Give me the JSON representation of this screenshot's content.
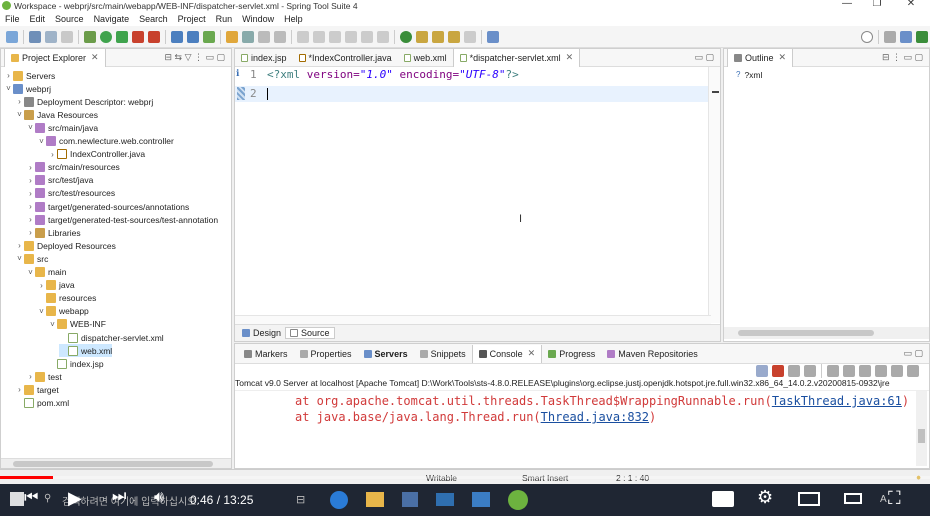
{
  "window": {
    "title": "Workspace - webprj/src/main/webapp/WEB-INF/dispatcher-servlet.xml - Spring Tool Suite 4"
  },
  "menu": [
    "File",
    "Edit",
    "Source",
    "Navigate",
    "Search",
    "Project",
    "Run",
    "Window",
    "Help"
  ],
  "explorer": {
    "title": "Project Explorer",
    "items": [
      {
        "label": "Servers",
        "icon": "folder",
        "arrow": "›",
        "depth": 0
      },
      {
        "label": "webprj",
        "icon": "proj",
        "arrow": "˅",
        "depth": 0
      },
      {
        "label": "Deployment Descriptor: webprj",
        "icon": "web",
        "arrow": "›",
        "depth": 1
      },
      {
        "label": "Java Resources",
        "icon": "lib",
        "arrow": "˅",
        "depth": 1
      },
      {
        "label": "src/main/java",
        "icon": "pkg",
        "arrow": "˅",
        "depth": 2
      },
      {
        "label": "com.newlecture.web.controller",
        "icon": "pkg",
        "arrow": "˅",
        "depth": 3
      },
      {
        "label": "IndexController.java",
        "icon": "java",
        "arrow": "›",
        "depth": 4
      },
      {
        "label": "src/main/resources",
        "icon": "pkg",
        "arrow": "›",
        "depth": 2
      },
      {
        "label": "src/test/java",
        "icon": "pkg",
        "arrow": "›",
        "depth": 2
      },
      {
        "label": "src/test/resources",
        "icon": "pkg",
        "arrow": "›",
        "depth": 2
      },
      {
        "label": "target/generated-sources/annotations",
        "icon": "pkg",
        "arrow": "›",
        "depth": 2
      },
      {
        "label": "target/generated-test-sources/test-annotation",
        "icon": "pkg",
        "arrow": "›",
        "depth": 2
      },
      {
        "label": "Libraries",
        "icon": "lib",
        "arrow": "›",
        "depth": 2
      },
      {
        "label": "Deployed Resources",
        "icon": "folder",
        "arrow": "›",
        "depth": 1
      },
      {
        "label": "src",
        "icon": "folder",
        "arrow": "˅",
        "depth": 1
      },
      {
        "label": "main",
        "icon": "folder",
        "arrow": "˅",
        "depth": 2
      },
      {
        "label": "java",
        "icon": "folder",
        "arrow": "›",
        "depth": 3
      },
      {
        "label": "resources",
        "icon": "folder",
        "arrow": "",
        "depth": 3
      },
      {
        "label": "webapp",
        "icon": "folder",
        "arrow": "˅",
        "depth": 3
      },
      {
        "label": "WEB-INF",
        "icon": "folder",
        "arrow": "˅",
        "depth": 4
      },
      {
        "label": "dispatcher-servlet.xml",
        "icon": "xml",
        "arrow": "",
        "depth": 5
      },
      {
        "label": "web.xml",
        "icon": "xml",
        "arrow": "",
        "depth": 5,
        "selected": true
      },
      {
        "label": "index.jsp",
        "icon": "xml",
        "arrow": "",
        "depth": 4
      },
      {
        "label": "test",
        "icon": "folder",
        "arrow": "›",
        "depth": 2
      },
      {
        "label": "target",
        "icon": "folder",
        "arrow": "›",
        "depth": 1
      },
      {
        "label": "pom.xml",
        "icon": "xml",
        "arrow": "",
        "depth": 1
      }
    ]
  },
  "editor": {
    "tabs": [
      {
        "label": "index.jsp",
        "active": false
      },
      {
        "label": "*IndexController.java",
        "active": false
      },
      {
        "label": "web.xml",
        "active": false
      },
      {
        "label": "*dispatcher-servlet.xml",
        "active": true
      }
    ],
    "line1_num": "1",
    "line2_num": "2",
    "code": {
      "open": "<?xml ",
      "attr1": "version=",
      "val1": "\"1.0\"",
      "attr2": " encoding=",
      "val2": "\"UTF-8\"",
      "close": "?>"
    },
    "bottom_tabs": [
      "Design",
      "Source"
    ]
  },
  "outline": {
    "title": "Outline",
    "item": "?xml"
  },
  "console": {
    "tabs": [
      "Markers",
      "Properties",
      "Servers",
      "Snippets",
      "Console",
      "Progress",
      "Maven Repositories"
    ],
    "header": "Tomcat v9.0 Server at localhost [Apache Tomcat] D:\\Work\\Tools\\sts-4.8.0.RELEASE\\plugins\\org.eclipse.justj.openjdk.hotspot.jre.full.win32.x86_64_14.0.2.v20200815-0932\\jre",
    "lines": [
      {
        "pre": "at org.apache.tomcat.util.threads.TaskThread$WrappingRunnable.run(",
        "link": "TaskThread.java:61",
        "post": ")"
      },
      {
        "pre": "at java.base/java.lang.Thread.run(",
        "link": "Thread.java:832",
        "post": ")"
      }
    ]
  },
  "status": {
    "writable": "Writable",
    "insert": "Smart Insert",
    "position": "2 : 1 : 40"
  },
  "video": {
    "time": "0:46 / 13:25",
    "search_text": "검색하려면 여기에 입력하십시오.",
    "progress": 0.057
  }
}
